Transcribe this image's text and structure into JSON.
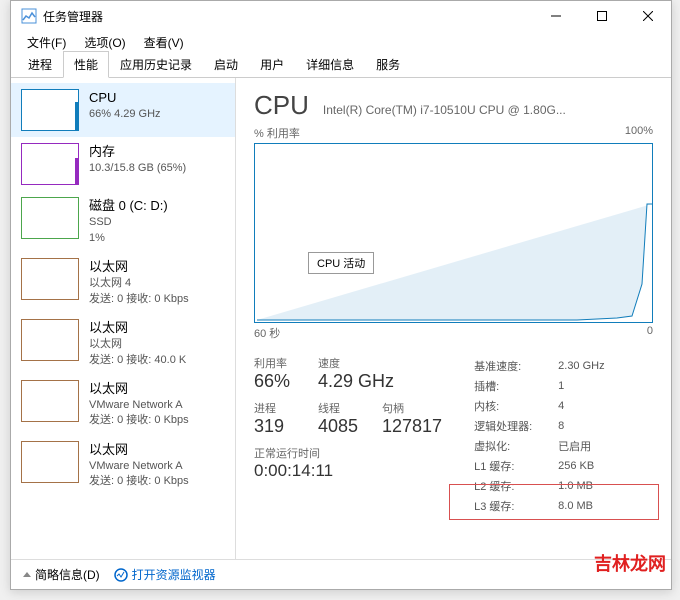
{
  "window": {
    "title": "任务管理器"
  },
  "menus": {
    "file": "文件(F)",
    "options": "选项(O)",
    "view": "查看(V)"
  },
  "tabs": {
    "processes": "进程",
    "performance": "性能",
    "app_history": "应用历史记录",
    "startup": "启动",
    "users": "用户",
    "details": "详细信息",
    "services": "服务"
  },
  "sidebar": {
    "cpu": {
      "title": "CPU",
      "sub": "66% 4.29 GHz"
    },
    "mem": {
      "title": "内存",
      "sub": "10.3/15.8 GB (65%)"
    },
    "disk": {
      "title": "磁盘 0 (C: D:)",
      "sub": "SSD",
      "line": "1%"
    },
    "eth4": {
      "title": "以太网",
      "sub": "以太网 4",
      "line": "发送: 0 接收: 0 Kbps"
    },
    "eth": {
      "title": "以太网",
      "sub": "以太网",
      "line": "发送: 0 接收: 40.0 K"
    },
    "vmnet1": {
      "title": "以太网",
      "sub": "VMware Network A",
      "line": "发送: 0 接收: 0 Kbps"
    },
    "vmnet2": {
      "title": "以太网",
      "sub": "VMware Network A",
      "line": "发送: 0 接收: 0 Kbps"
    }
  },
  "main": {
    "title": "CPU",
    "model": "Intel(R) Core(TM) i7-10510U CPU @ 1.80G...",
    "chart_y_label": "% 利用率",
    "chart_y_max": "100%",
    "chart_x_left": "60 秒",
    "chart_x_right": "0",
    "tooltip": "CPU 活动",
    "stats": {
      "util_label": "利用率",
      "util": "66%",
      "speed_label": "速度",
      "speed": "4.29 GHz",
      "proc_label": "进程",
      "proc": "319",
      "threads_label": "线程",
      "threads": "4085",
      "handles_label": "句柄",
      "handles": "127817",
      "uptime_label": "正常运行时间",
      "uptime": "0:00:14:11"
    },
    "right": {
      "base_speed_l": "基准速度:",
      "base_speed_v": "2.30 GHz",
      "sockets_l": "插槽:",
      "sockets_v": "1",
      "cores_l": "内核:",
      "cores_v": "4",
      "logical_l": "逻辑处理器:",
      "logical_v": "8",
      "virt_l": "虚拟化:",
      "virt_v": "已启用",
      "l1_l": "L1 缓存:",
      "l1_v": "256 KB",
      "l2_l": "L2 缓存:",
      "l2_v": "1.0 MB",
      "l3_l": "L3 缓存:",
      "l3_v": "8.0 MB"
    }
  },
  "chart_data": {
    "type": "line",
    "title": "% 利用率",
    "xlabel": "秒",
    "ylabel": "% 利用率",
    "xlim": [
      60,
      0
    ],
    "ylim": [
      0,
      100
    ],
    "x": [
      60,
      50,
      40,
      30,
      20,
      10,
      5,
      3,
      1,
      0
    ],
    "values": [
      2,
      2,
      2,
      2,
      2,
      3,
      5,
      20,
      66,
      66
    ]
  },
  "bottom": {
    "fewer": "简略信息(D)",
    "resmon": "打开资源监视器"
  },
  "watermark": "吉林龙网"
}
